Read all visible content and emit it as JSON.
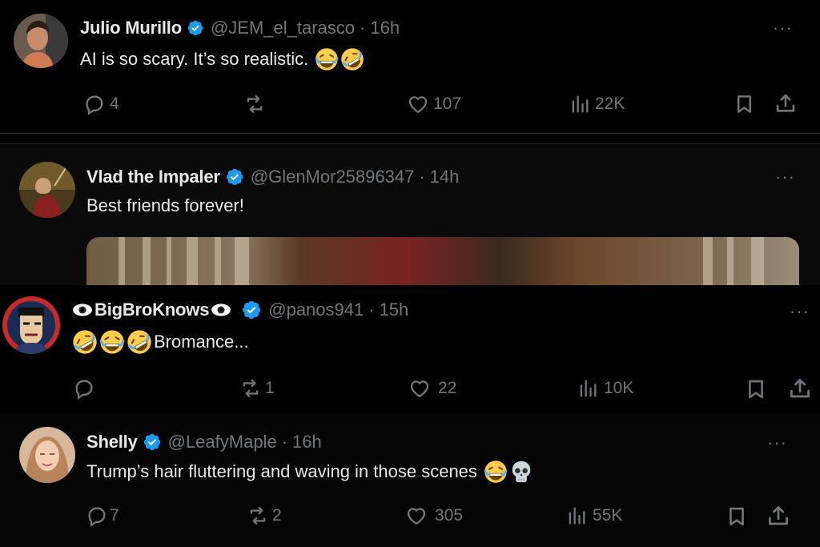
{
  "tweets": [
    {
      "name": "Julio Murillo",
      "handle": "@JEM_el_tarasco",
      "time": "16h",
      "text": "AI is so scary. It’s so realistic.",
      "emojis": [
        "face-with-tears-of-joy",
        "rolling-on-the-floor-laughing"
      ],
      "verified": true,
      "stats": {
        "replies": "4",
        "reposts": "",
        "likes": "107",
        "views": "22K"
      }
    },
    {
      "name": "Vlad the Impaler",
      "handle": "@GlenMor25896347",
      "time": "14h",
      "text": "Best friends forever!",
      "verified": true,
      "has_media": true
    },
    {
      "name_prefix_icon": "eye-icon",
      "name": "BigBroKnows",
      "name_suffix_icon": "eye-icon",
      "handle": "@panos941",
      "time": "15h",
      "text": "Bromance...",
      "emojis_before_text": [
        "rolling-on-the-floor-laughing",
        "face-with-tears-of-joy",
        "rolling-on-the-floor-laughing"
      ],
      "verified": true,
      "stats": {
        "replies": "",
        "reposts": "1",
        "likes": "22",
        "views": "10K"
      }
    },
    {
      "name": "Shelly",
      "handle": "@LeafyMaple",
      "time": "16h",
      "text": "Trump’s hair fluttering and waving in those scenes",
      "emojis": [
        "face-with-tears-of-joy",
        "skull"
      ],
      "verified": true,
      "stats": {
        "replies": "7",
        "reposts": "2",
        "likes": "305",
        "views": "55K"
      }
    }
  ],
  "separator": "·",
  "more_label": "···",
  "colors": {
    "background": "#000000",
    "text": "#e7e9ea",
    "muted": "#71767b",
    "verified_blue": "#1d9bf0",
    "divider": "#2f3336"
  },
  "icons": [
    "reply-icon",
    "repost-icon",
    "like-icon",
    "views-icon",
    "bookmark-icon",
    "share-icon",
    "more-icon",
    "verified-badge-icon"
  ]
}
